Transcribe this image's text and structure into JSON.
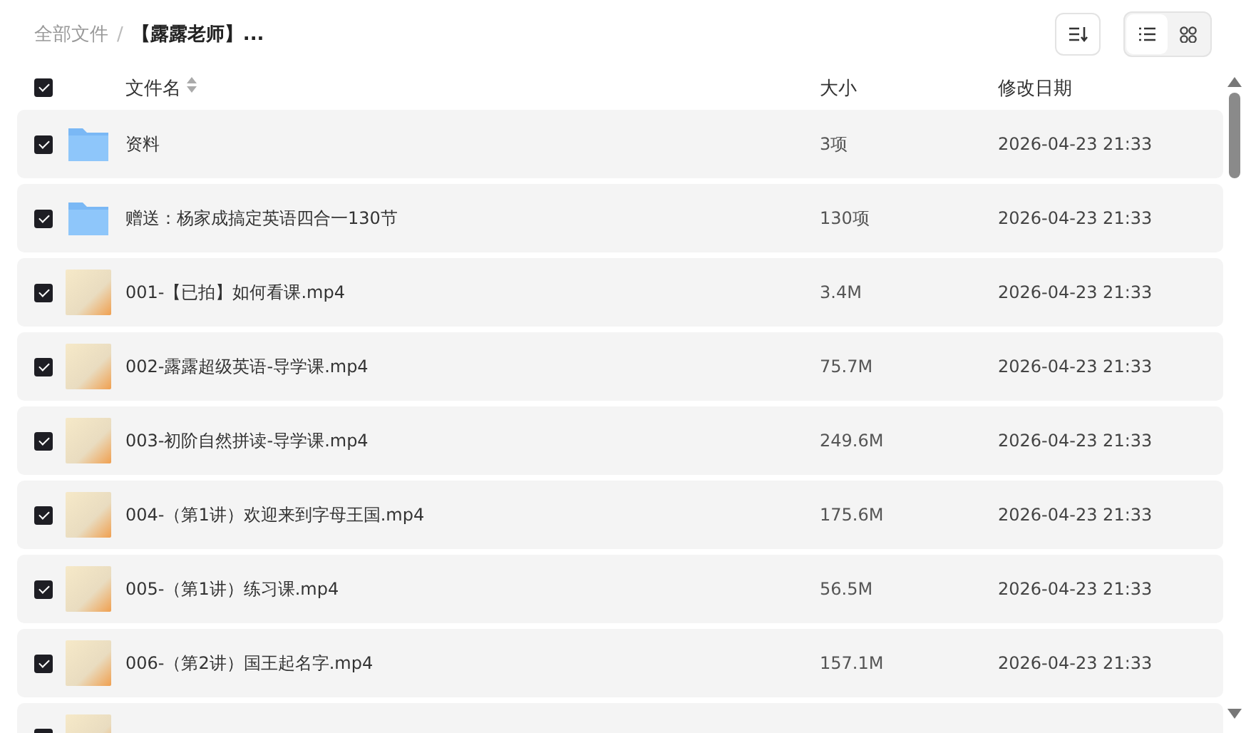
{
  "breadcrumb": [
    {
      "label": "全部文件",
      "current": false
    },
    {
      "label": "/",
      "kind": "separator"
    },
    {
      "label": "【露露老师】...",
      "current": true
    }
  ],
  "toolbar": {
    "view_modes": [
      {
        "kind": "list",
        "selected": true
      },
      {
        "kind": "grid",
        "selected": false
      }
    ]
  },
  "table": {
    "select_all": {
      "checked": true
    },
    "columns": [
      {
        "label": "文件名",
        "sortable": true
      },
      {
        "label": "大小",
        "sortable": false
      },
      {
        "label": "修改日期",
        "sortable": false
      }
    ],
    "rows": [
      {
        "kind": "folder",
        "checked": true,
        "name": "资料",
        "size": "3项",
        "modified": "2026-04-23 21:33"
      },
      {
        "kind": "folder",
        "checked": true,
        "name": "赠送：杨家成搞定英语四合一130节",
        "size": "130项",
        "modified": "2026-04-23 21:33"
      },
      {
        "kind": "video",
        "checked": true,
        "name": "001-【已拍】如何看课.mp4",
        "size": "3.4M",
        "modified": "2026-04-23 21:33"
      },
      {
        "kind": "video",
        "checked": true,
        "name": "002-露露超级英语-导学课.mp4",
        "size": "75.7M",
        "modified": "2026-04-23 21:33"
      },
      {
        "kind": "video",
        "checked": true,
        "name": "003-初阶自然拼读-导学课.mp4",
        "size": "249.6M",
        "modified": "2026-04-23 21:33"
      },
      {
        "kind": "video",
        "checked": true,
        "name": "004-（第1讲）欢迎来到字母王国.mp4",
        "size": "175.6M",
        "modified": "2026-04-23 21:33"
      },
      {
        "kind": "video",
        "checked": true,
        "name": "005-（第1讲）练习课.mp4",
        "size": "56.5M",
        "modified": "2026-04-23 21:33"
      },
      {
        "kind": "video",
        "checked": true,
        "name": "006-（第2讲）国王起名字.mp4",
        "size": "157.1M",
        "modified": "2026-04-23 21:33"
      },
      {
        "kind": "video",
        "checked": true
      }
    ]
  }
}
